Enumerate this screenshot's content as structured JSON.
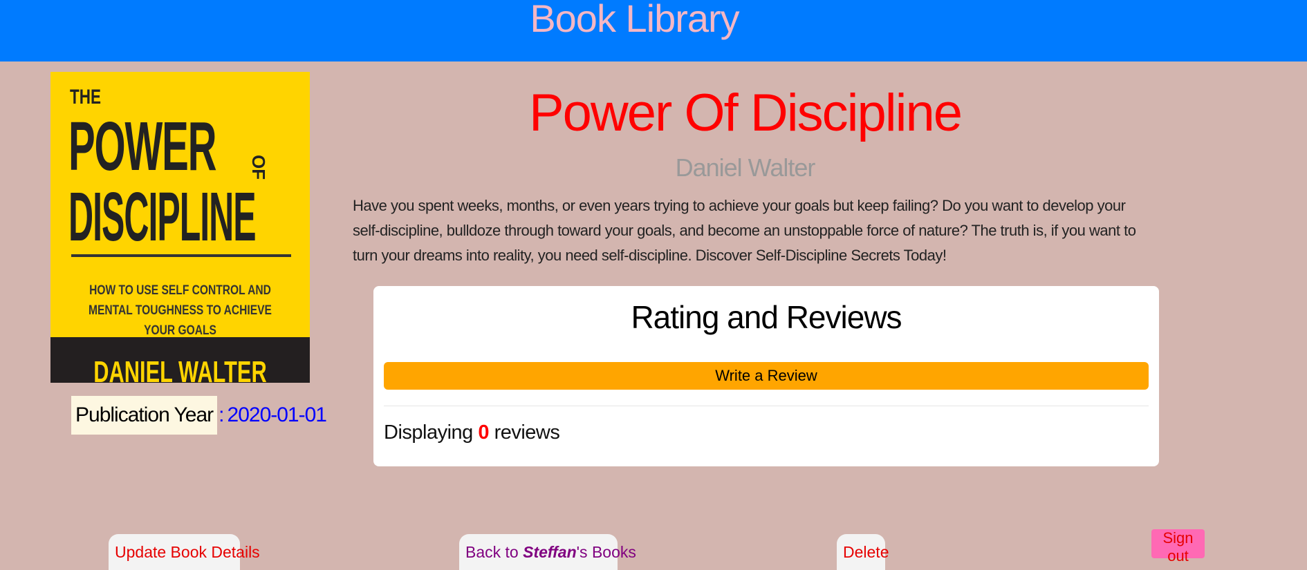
{
  "header": {
    "title": "Book Library"
  },
  "cover": {
    "line1": "THE",
    "line2": "POWER",
    "line2_small": "OF",
    "line3": "DISCIPLINE",
    "subtitle": "HOW TO USE SELF CONTROL AND MENTAL TOUGHNESS TO ACHIEVE YOUR GOALS",
    "author": "DANIEL WALTER"
  },
  "publication": {
    "label": "Publication Year",
    "separator": ":",
    "value": "2020-01-01"
  },
  "book": {
    "title": "Power Of Discipline",
    "author": "Daniel Walter",
    "description": "Have you spent weeks, months, or even years trying to achieve your goals but keep failing? Do you want to develop your self-discipline, bulldoze through toward your goals, and become an unstoppable force of nature? The truth is, if you want to turn your dreams into reality, you need self-discipline. Discover Self-Discipline Secrets Today!"
  },
  "reviews": {
    "title": "Rating and Reviews",
    "write_label": "Write a Review",
    "displaying_prefix": "Displaying",
    "count": "0",
    "displaying_suffix": "reviews"
  },
  "actions": {
    "update_label": "Update Book Details",
    "back_prefix": "Back to ",
    "back_user": "Steffan",
    "back_suffix": "'s Books",
    "delete_label": "Delete",
    "signout_label": "Sign out"
  },
  "colors": {
    "header_bg": "#007bff",
    "page_bg": "#d3b5af",
    "title_red": "#ff0000",
    "write_review_bg": "#ffa500",
    "signout_bg": "#ff69b4"
  }
}
